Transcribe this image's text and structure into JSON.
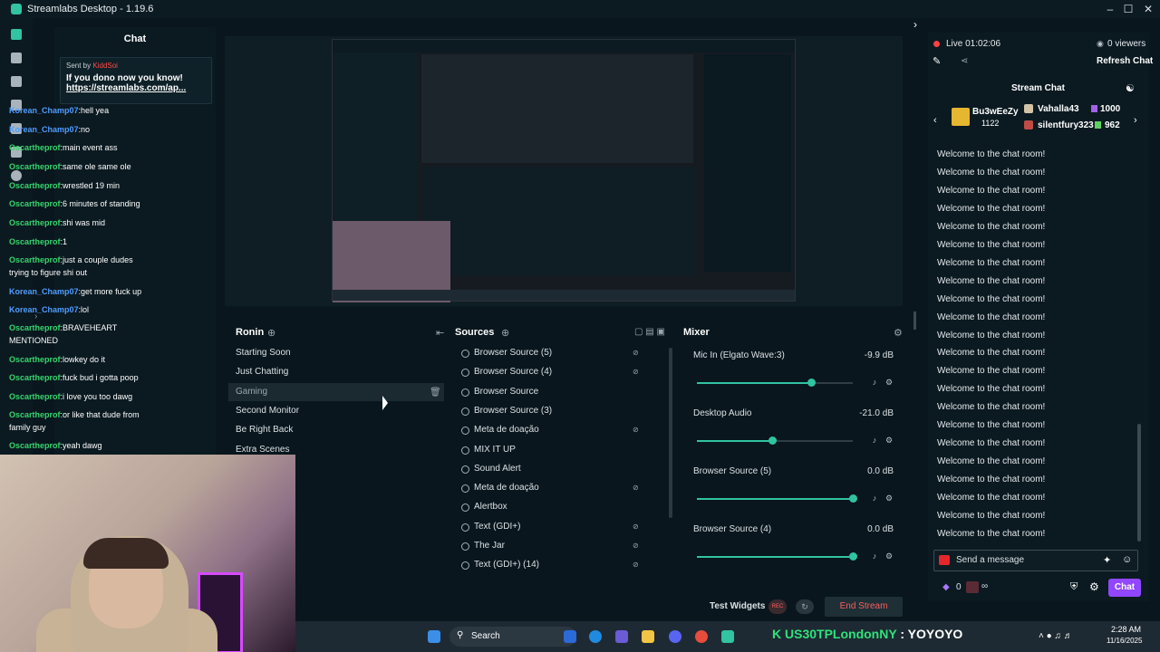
{
  "window": {
    "title": "Streamlabs Desktop - 1.19.6"
  },
  "chat": {
    "header": "Chat",
    "pinned": {
      "sent_by": "Sent by",
      "sender": "KiddSoi",
      "message": "If you dono now you know!",
      "link": "https://streamlabs.com/ap..."
    },
    "messages": [
      {
        "user": "Korean_Champ07",
        "text": "hell yea",
        "color": "#4f9cff"
      },
      {
        "user": "Korean_Champ07",
        "text": "no",
        "color": "#4f9cff"
      },
      {
        "user": "Oscartheprof",
        "text": "main event ass",
        "color": "#35d56c"
      },
      {
        "user": "Oscartheprof",
        "text": "same ole same ole",
        "color": "#35d56c"
      },
      {
        "user": "Oscartheprof",
        "text": "wrestled 19 min",
        "color": "#35d56c"
      },
      {
        "user": "Oscartheprof",
        "text": "6 minutes of standing",
        "color": "#35d56c"
      },
      {
        "user": "Oscartheprof",
        "text": "shi was mid",
        "color": "#35d56c"
      },
      {
        "user": "Oscartheprof",
        "text": "1",
        "color": "#35d56c"
      },
      {
        "user": "Oscartheprof",
        "text": "just a couple dudes trying to figure shi out",
        "color": "#35d56c"
      },
      {
        "user": "Korean_Champ07",
        "text": "get more fuck up",
        "color": "#4f9cff"
      },
      {
        "user": "Korean_Champ07",
        "text": "lol",
        "color": "#4f9cff"
      },
      {
        "user": "Oscartheprof",
        "text": "BRAVEHEART MENTIONED",
        "color": "#35d56c"
      },
      {
        "user": "Oscartheprof",
        "text": "lowkey do it",
        "color": "#35d56c"
      },
      {
        "user": "Oscartheprof",
        "text": "fuck bud i gotta poop",
        "color": "#35d56c"
      },
      {
        "user": "Oscartheprof",
        "text": "i love you too dawg",
        "color": "#35d56c"
      },
      {
        "user": "Oscartheprof",
        "text": "or like that dude from family guy",
        "color": "#35d56c"
      },
      {
        "user": "Oscartheprof",
        "text": "yeah dawg",
        "color": "#35d56c"
      }
    ]
  },
  "scenes": {
    "title": "Ronin",
    "items": [
      "Starting Soon",
      "Just Chatting",
      "Gaming",
      "Second Monitor",
      "Be Right Back",
      "Extra Scenes"
    ],
    "active": "Gaming"
  },
  "sources": {
    "title": "Sources",
    "items": [
      {
        "name": "Browser Source (5)",
        "hidden": true
      },
      {
        "name": "Browser Source (4)",
        "hidden": true
      },
      {
        "name": "Browser Source",
        "hidden": false
      },
      {
        "name": "Browser Source (3)",
        "hidden": false
      },
      {
        "name": "Meta de doação",
        "hidden": true
      },
      {
        "name": "MIX IT UP",
        "hidden": false
      },
      {
        "name": "Sound Alert",
        "hidden": false
      },
      {
        "name": "Meta de doação",
        "hidden": true
      },
      {
        "name": "Alertbox",
        "hidden": false
      },
      {
        "name": "Text (GDI+)",
        "hidden": true
      },
      {
        "name": "The Jar",
        "hidden": true
      },
      {
        "name": "Text (GDI+) (14)",
        "hidden": true
      }
    ]
  },
  "mixer": {
    "title": "Mixer",
    "channels": [
      {
        "name": "Mic In (Elgato Wave:3)",
        "db": "-9.9 dB",
        "level": 0.73
      },
      {
        "name": "Desktop Audio",
        "db": "-21.0 dB",
        "level": 0.48
      },
      {
        "name": "Browser Source (5)",
        "db": "0.0 dB",
        "level": 1.0
      },
      {
        "name": "Browser Source (4)",
        "db": "0.0 dB",
        "level": 1.0
      }
    ]
  },
  "bottom": {
    "test_widgets": "Test Widgets",
    "end_stream": "End Stream",
    "rec": "REC"
  },
  "stream": {
    "live": "Live 01:02:06",
    "viewers": "0 viewers",
    "refresh": "Refresh Chat",
    "chat_title": "Stream Chat",
    "top1_name": "Bu3wEeZy",
    "top1_score": "1122",
    "top2_name": "Vahalla43",
    "top2_score": "1000",
    "top3_name": "silentfury323",
    "top3_score": "962",
    "welcome": "Welcome to the chat room!",
    "welcome_count": 22,
    "input_placeholder": "Send a message",
    "points": "0",
    "chat_button": "Chat"
  },
  "taskbar": {
    "search": "Search",
    "ticker_prefix": "K",
    "ticker_name": "US30TPLondonNY",
    "ticker_msg": ": YOYOYO",
    "time": "2:28 AM",
    "date": "11/16/2025"
  },
  "colors": {
    "accent": "#31c3a2",
    "end_stream": "#ff5d5d",
    "live_dot": "#ff4040"
  }
}
